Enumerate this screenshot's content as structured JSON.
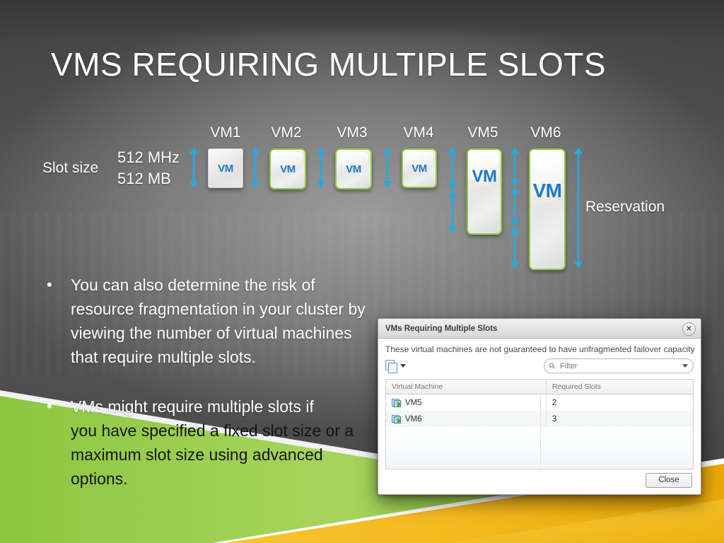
{
  "slide": {
    "title": "VMs Requiring Multiple Slots"
  },
  "diagram": {
    "slot_size_label": "Slot size",
    "slot_size_cpu": "512 MHz",
    "slot_size_mem": "512 MB",
    "reservation_label": "Reservation",
    "vm_box_text": "VM",
    "vms": [
      {
        "label": "VM1",
        "slots": 1,
        "bordered": false
      },
      {
        "label": "VM2",
        "slots": 1,
        "bordered": true
      },
      {
        "label": "VM3",
        "slots": 1,
        "bordered": true
      },
      {
        "label": "VM4",
        "slots": 1,
        "bordered": true
      },
      {
        "label": "VM5",
        "slots": 2,
        "bordered": true
      },
      {
        "label": "VM6",
        "slots": 3,
        "bordered": true
      }
    ]
  },
  "bullets": [
    {
      "marker": "•",
      "text": "You can also determine the risk of resource fragmentation in your cluster by viewing the number of virtual machines that require multiple slots."
    },
    {
      "marker": "•",
      "line1": "VMs might require multiple slots if",
      "line2": "you have specified a fixed slot size or a maximum slot size using advanced options."
    }
  ],
  "dialog": {
    "title": "VMs Requiring Multiple Slots",
    "close_icon": "close-icon",
    "subtitle": "These virtual machines are not guaranteed to have unfragmented failover capacity",
    "copy_icon": "copy-icon",
    "copy_caret_icon": "chevron-down-icon",
    "filter": {
      "icon": "search-icon",
      "value": "",
      "placeholder": "Filter",
      "caret_icon": "chevron-down-icon"
    },
    "columns": [
      "Virtual Machine",
      "Required Slots"
    ],
    "rows": [
      {
        "icon": "virtual-machine-icon",
        "name": "VM5",
        "slots": "2"
      },
      {
        "icon": "virtual-machine-icon",
        "name": "VM6",
        "slots": "3"
      }
    ],
    "close_button": "Close"
  },
  "colors": {
    "accent_green": "#93c83e",
    "accent_yellow": "#f0b323",
    "arrow_blue": "#29a8e0",
    "vm_text_blue": "#1f78c1",
    "background_dark": "#454545"
  }
}
